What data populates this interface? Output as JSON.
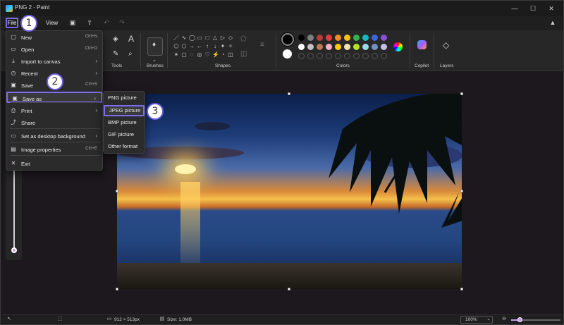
{
  "window": {
    "title": "PNG 2 - Paint",
    "minimize": "—",
    "maximize": "☐",
    "close": "✕"
  },
  "menubar": {
    "file_label": "File",
    "view_label": "View"
  },
  "badges": [
    "1",
    "2",
    "3"
  ],
  "ribbon": {
    "groups": {
      "tools": "Tools",
      "brushes": "Brushes",
      "shapes": "Shapes",
      "colors": "Colors",
      "copilot": "Copilot",
      "layers": "Layers"
    },
    "palette_row1": [
      "#000000",
      "#7f7f7f",
      "#b83b3b",
      "#e03a3a",
      "#f08c2a",
      "#f2c318",
      "#33b24a",
      "#17b8c0",
      "#3668d9",
      "#8b4fd6"
    ],
    "palette_row2": [
      "#ffffff",
      "#c3c3c3",
      "#b97a57",
      "#ffaec9",
      "#ffc90e",
      "#efe4b0",
      "#b5e61d",
      "#99d9ea",
      "#7092be",
      "#c8bfe7"
    ]
  },
  "file_menu": {
    "items": [
      {
        "label": "New",
        "shortcut": "Ctrl+N",
        "icon": "new-file-icon"
      },
      {
        "label": "Open",
        "shortcut": "Ctrl+O",
        "icon": "folder-icon"
      },
      {
        "label": "Import to canvas",
        "shortcut": "",
        "icon": "import-icon",
        "submenu": true
      },
      {
        "label": "Recent",
        "shortcut": "",
        "icon": "clock-icon",
        "submenu": true
      },
      {
        "label": "Save",
        "shortcut": "Ctrl+S",
        "icon": "save-icon"
      },
      {
        "label": "Save as",
        "shortcut": "",
        "icon": "save-as-icon",
        "submenu": true,
        "selected": true
      },
      {
        "label": "Print",
        "shortcut": "",
        "icon": "print-icon",
        "submenu": true
      },
      {
        "label": "Share",
        "shortcut": "",
        "icon": "share-icon"
      },
      {
        "label": "Set as desktop background",
        "shortcut": "",
        "icon": "desktop-icon",
        "submenu": true
      },
      {
        "label": "Image properties",
        "shortcut": "Ctrl+E",
        "icon": "properties-icon"
      },
      {
        "label": "Exit",
        "shortcut": "",
        "icon": "close-icon"
      }
    ]
  },
  "save_as_menu": {
    "items": [
      {
        "label": "PNG picture"
      },
      {
        "label": "JPEG picture",
        "selected": true
      },
      {
        "label": "BMP picture"
      },
      {
        "label": "GIF picture"
      },
      {
        "label": "Other format"
      }
    ]
  },
  "status": {
    "dimensions": "912 × 513px",
    "size": "Size: 1.0MB",
    "zoom": "100%",
    "zoom_level_percent": 100
  }
}
